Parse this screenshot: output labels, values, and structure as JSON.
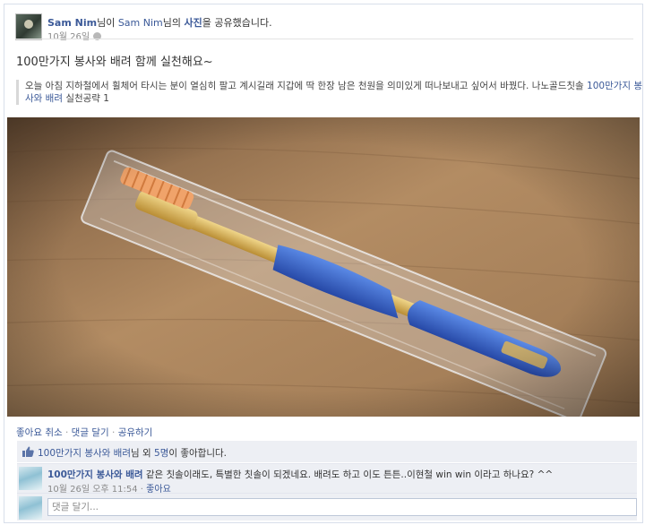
{
  "header": {
    "actor": "Sam Nim",
    "actor_suffix": "님이",
    "owner": "Sam Nim",
    "owner_suffix": "님의",
    "object": "사진",
    "verb": "을 공유했습니다.",
    "date": "10월 26일"
  },
  "post": {
    "title": "100만가지 봉사와 배려 함께 실천해요~",
    "quote_text": "오늘 아침 지하철에서 휠체어 타시는 분이 열심히 팔고 계시길래 지갑에 딱 한장 남은 천원을 의미있게 떠나보내고 싶어서 바꿨다. 나노골드칫솔",
    "quote_link": "100만가지 봉사와 배려",
    "quote_tail": "실천공략 1"
  },
  "actions": {
    "unlike": "좋아요 취소",
    "comment": "댓글 달기",
    "share": "공유하기",
    "separator": "·"
  },
  "likes": {
    "page": "100만가지 봉사와 배려",
    "middle": "님 외",
    "count": "5명",
    "tail": "이 좋아합니다."
  },
  "comment": {
    "author": "100만가지 봉사와 배려",
    "text": "같은 칫솔이래도, 특별한 칫솔이 되겠네요. 배려도 하고 이도 튼튼..이현철 win win 이라고 하나요? ^^",
    "time": "10월 26일 오후 11:54",
    "like": "좋아요"
  },
  "comment_input": {
    "placeholder": "댓글 달기..."
  },
  "colors": {
    "link": "#3b5998",
    "panel": "#edeff4",
    "toothbrush_blue": "#3565c9",
    "bristles": "#f0a36a",
    "handle_gold": "#d8b25a"
  }
}
